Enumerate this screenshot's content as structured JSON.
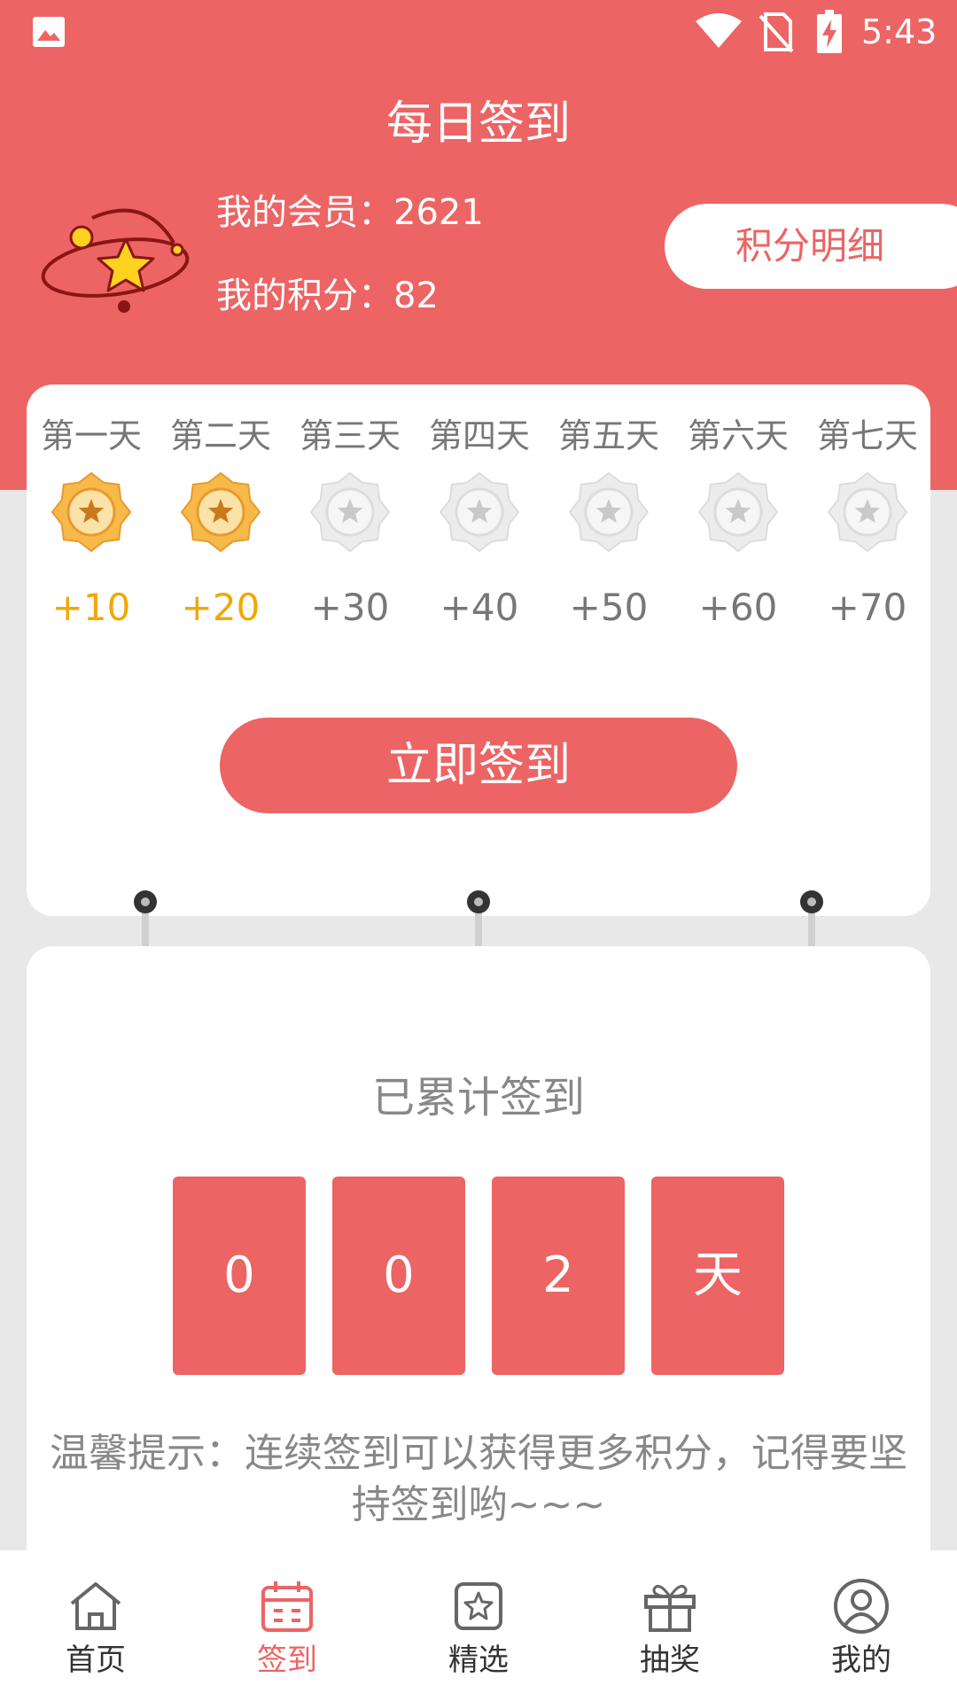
{
  "status_bar": {
    "time": "5:43",
    "icons": [
      "gallery-icon",
      "wifi-icon",
      "no-sim-icon",
      "battery-charging-icon"
    ]
  },
  "header": {
    "title": "每日签到",
    "member": "我的会员：2621",
    "points": "我的积分：82",
    "detail_button": "积分明细",
    "icon": "planet-star-icon"
  },
  "checkin": {
    "days": [
      {
        "label": "第一天",
        "reward": "+10",
        "claimed": true
      },
      {
        "label": "第二天",
        "reward": "+20",
        "claimed": true
      },
      {
        "label": "第三天",
        "reward": "+30",
        "claimed": false
      },
      {
        "label": "第四天",
        "reward": "+40",
        "claimed": false
      },
      {
        "label": "第五天",
        "reward": "+50",
        "claimed": false
      },
      {
        "label": "第六天",
        "reward": "+60",
        "claimed": false
      },
      {
        "label": "第七天",
        "reward": "+70",
        "claimed": false
      }
    ],
    "button": "立即签到"
  },
  "summary": {
    "label": "已累计签到",
    "digits": [
      "0",
      "0",
      "2",
      "天"
    ],
    "tip": "温馨提示：连续签到可以获得更多积分，记得要坚持签到哟~~~"
  },
  "nav": {
    "items": [
      {
        "label": "首页",
        "icon": "home-icon",
        "active": false
      },
      {
        "label": "签到",
        "icon": "calendar-icon",
        "active": true
      },
      {
        "label": "精选",
        "icon": "star-box-icon",
        "active": false
      },
      {
        "label": "抽奖",
        "icon": "gift-icon",
        "active": false
      },
      {
        "label": "我的",
        "icon": "user-icon",
        "active": false
      }
    ]
  },
  "colors": {
    "primary": "#ec6464",
    "gold": "#f0a800",
    "reward_inactive": "#777777",
    "background": "#e8e8e8"
  }
}
